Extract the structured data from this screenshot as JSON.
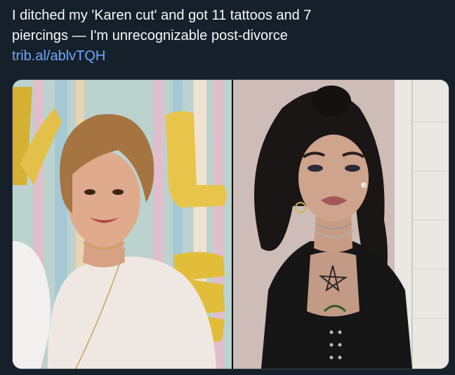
{
  "tweet": {
    "text_line1": "I ditched my 'Karen cut' and got 11 tattoos and 7",
    "text_line2": "piercings — I'm unrecognizable post-divorce",
    "link": "trib.al/ablvTQH"
  },
  "media": {
    "left_photo": "photo-before",
    "right_photo": "photo-after"
  },
  "colors": {
    "background": "#15202b",
    "text": "#f7f9f9",
    "link": "#6ea8ff"
  }
}
